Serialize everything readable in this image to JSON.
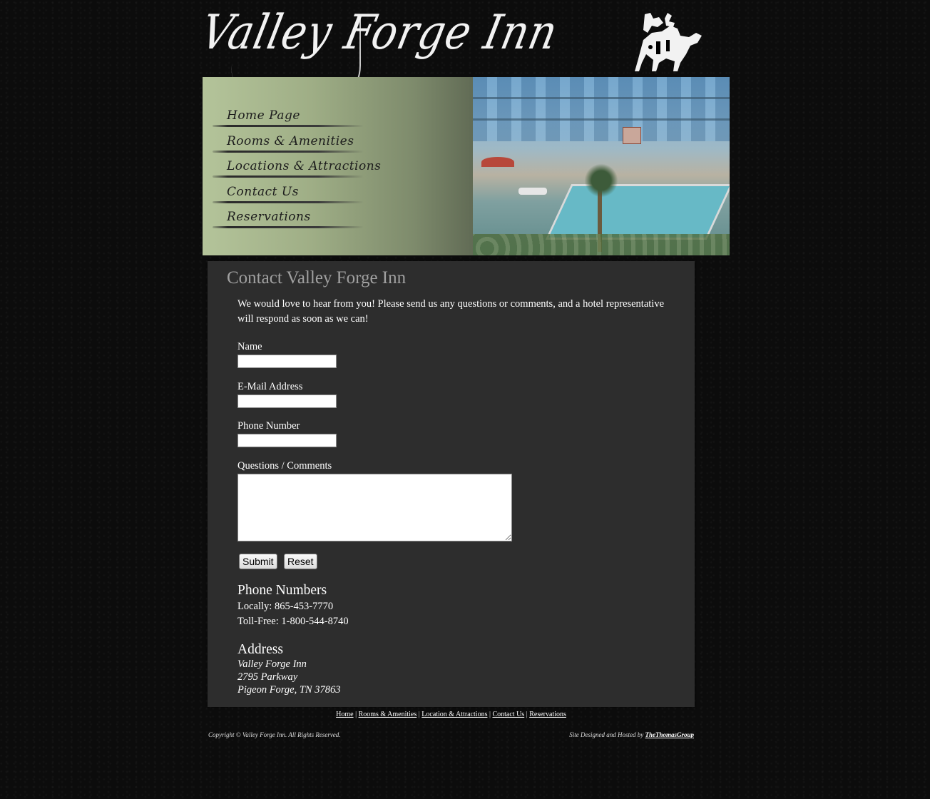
{
  "header": {
    "logo_text": "Valley Forge Inn"
  },
  "nav": {
    "items": [
      {
        "label": "Home Page"
      },
      {
        "label": "Rooms & Amenities"
      },
      {
        "label": "Locations & Attractions"
      },
      {
        "label": "Contact Us"
      },
      {
        "label": "Reservations"
      }
    ]
  },
  "main": {
    "title": "Contact Valley Forge Inn",
    "intro": "We would love to hear from you! Please send us any questions or comments, and a hotel representative will respond as soon as we can!",
    "form": {
      "name_label": "Name",
      "email_label": "E-Mail Address",
      "phone_label": "Phone Number",
      "comments_label": "Questions / Comments",
      "submit_label": "Submit",
      "reset_label": "Reset"
    },
    "phones": {
      "heading": "Phone Numbers",
      "local": "Locally: 865-453-7770",
      "tollfree": "Toll-Free: 1-800-544-8740"
    },
    "address": {
      "heading": "Address",
      "line1": "Valley Forge Inn",
      "line2": "2795 Parkway",
      "line3": "Pigeon Forge, TN 37863"
    }
  },
  "footer": {
    "links": [
      "Home",
      "Rooms & Amenities",
      "Location & Attractions",
      "Contact Us",
      "Reservations"
    ],
    "separator": "|",
    "copyright": "Copyright © Valley Forge Inn. All Rights Reserved.",
    "credit_prefix": "Site Designed and Hosted by",
    "credit_link": "TheThomasGroup"
  },
  "colors": {
    "background": "#0c0c0c",
    "content_panel": "#2d2d2d",
    "title": "#a0a0a0",
    "nav_panel": "#9fae86"
  }
}
